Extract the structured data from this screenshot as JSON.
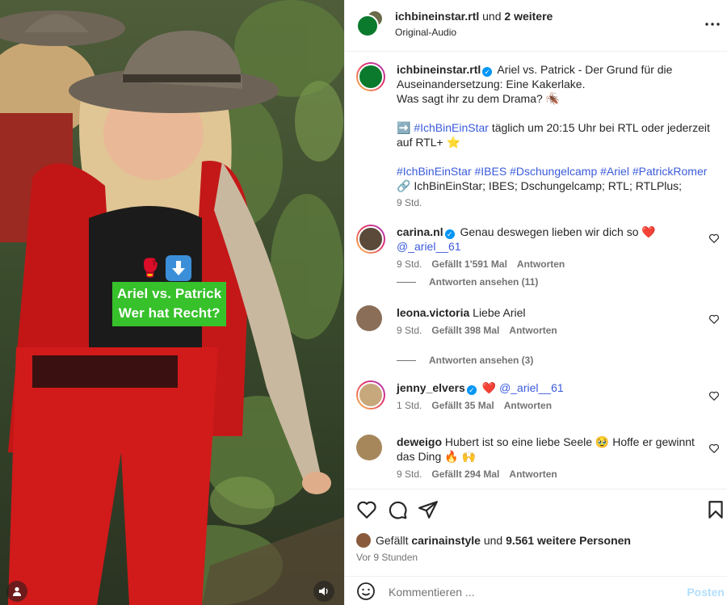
{
  "media": {
    "overlay_line1": "Ariel vs. Patrick",
    "overlay_line2": "Wer hat Recht?",
    "overlay_emojis": [
      "boxing-glove-icon",
      "down-arrow-icon"
    ]
  },
  "post_header": {
    "account": "ichbineinstar.rtl",
    "and_text": "und",
    "others": "2 weitere",
    "audio": "Original-Audio"
  },
  "caption": {
    "username": "ichbineinstar.rtl",
    "text_line1": "Ariel vs. Patrick - Der Grund für die Auseinandersetzung: Eine Kakerlake.",
    "text_line2": "Was sagt ihr zu dem Drama? 🪳",
    "promo_arrow": "➡️",
    "promo_tag": "#IchBinEinStar",
    "promo_text": " täglich um 20:15 Uhr bei RTL oder jederzeit auf RTL+ ⭐",
    "hashtags": "#IchBinEinStar #IBES #Dschungelcamp #Ariel #PatrickRomer",
    "keywords": "IchBinEinStar; IBES; Dschungelcamp; RTL; RTLPlus;",
    "time": "9 Std."
  },
  "comments": [
    {
      "username": "carina.nl",
      "verified": true,
      "text": "Genau deswegen lieben wir dich so ❤️ ",
      "mention": "@_ariel__61",
      "time": "9 Std.",
      "likes": "Gefällt 1'591 Mal",
      "reply": "Antworten",
      "view_replies": "Antworten ansehen (11)"
    },
    {
      "username": "leona.victoria",
      "verified": false,
      "text": "Liebe Ariel",
      "mention": "",
      "time": "9 Std.",
      "likes": "Gefällt 398 Mal",
      "reply": "Antworten",
      "view_replies": "Antworten ansehen (3)"
    },
    {
      "username": "jenny_elvers",
      "verified": true,
      "text": "❤️ ",
      "mention": "@_ariel__61",
      "time": "1 Std.",
      "likes": "Gefällt 35 Mal",
      "reply": "Antworten",
      "view_replies": ""
    },
    {
      "username": "deweigo",
      "verified": false,
      "text": "Hubert ist so eine liebe Seele 🥹 Hoffe er gewinnt das Ding 🔥 🙌",
      "mention": "",
      "time": "9 Std.",
      "likes": "Gefällt 294 Mal",
      "reply": "Antworten",
      "view_replies": ""
    }
  ],
  "actions": {
    "liked_by_prefix": "Gefällt",
    "liked_by_user": "carinainstyle",
    "liked_by_mid": "und",
    "liked_by_count": "9.561 weitere Personen",
    "posted_ago": "Vor 9 Stunden"
  },
  "composer": {
    "placeholder": "Kommentieren ...",
    "post_label": "Posten"
  },
  "colors": {
    "verified": "#0095f6",
    "link": "#00376b",
    "hashtag": "#3b5bdb",
    "overlay_green": "#37c12b",
    "post_disabled": "#b2dffc"
  }
}
